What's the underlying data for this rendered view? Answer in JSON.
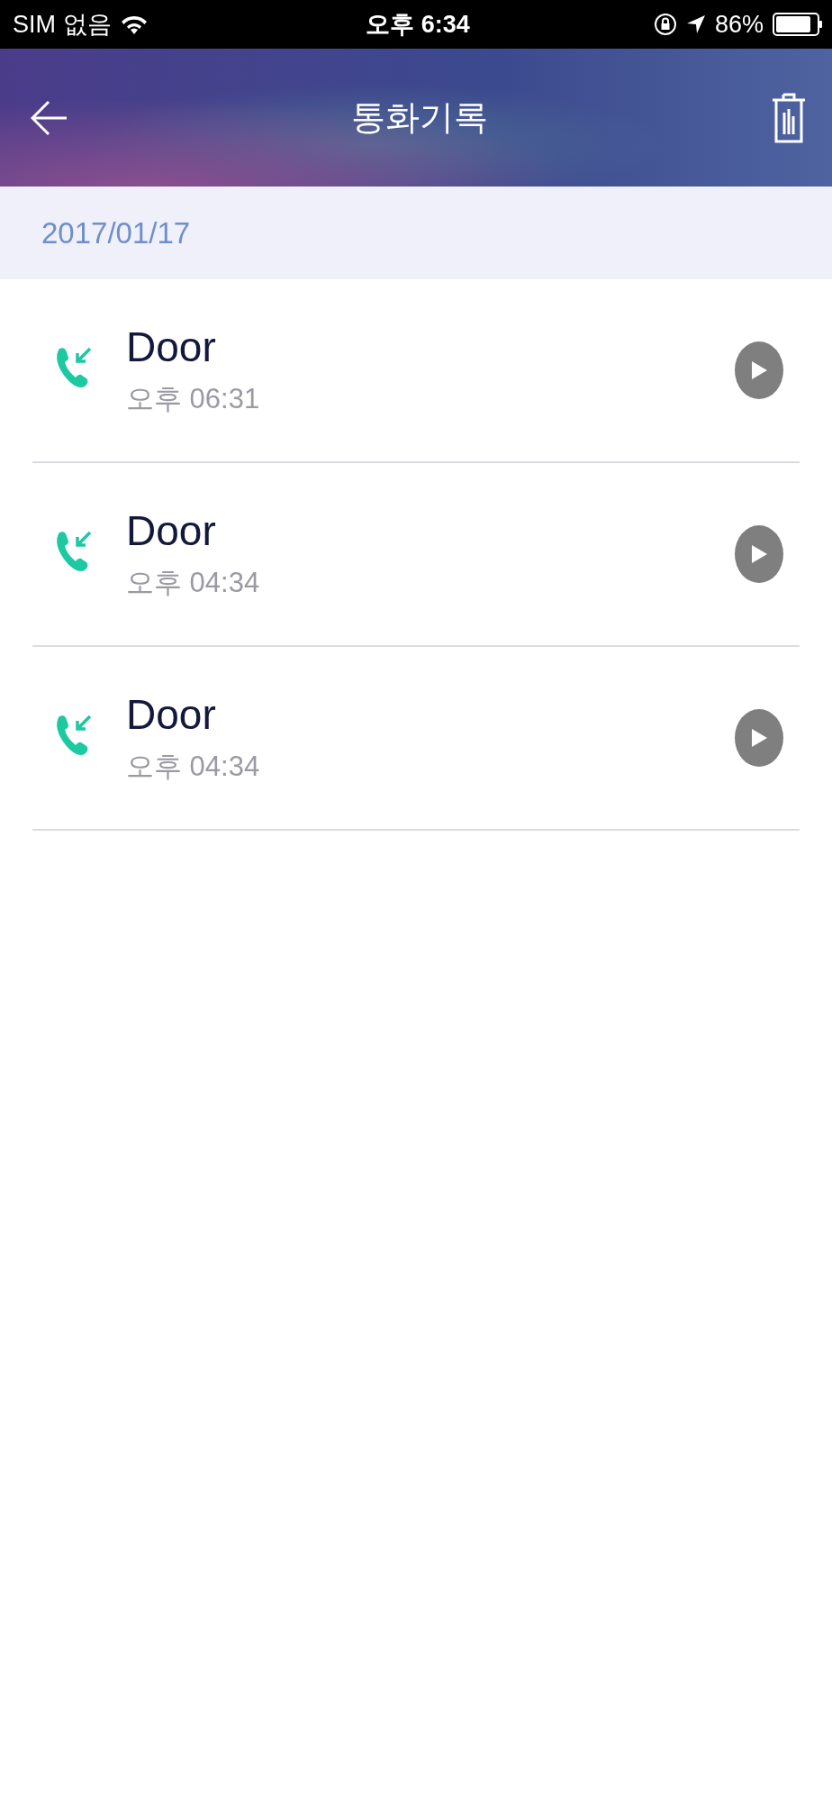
{
  "status_bar": {
    "carrier": "SIM 없음",
    "time": "오후 6:34",
    "battery": "86%"
  },
  "header": {
    "title": "통화기록"
  },
  "date_header": "2017/01/17",
  "calls": [
    {
      "name": "Door",
      "time": "오후 06:31"
    },
    {
      "name": "Door",
      "time": "오후 04:34"
    },
    {
      "name": "Door",
      "time": "오후 04:34"
    }
  ]
}
